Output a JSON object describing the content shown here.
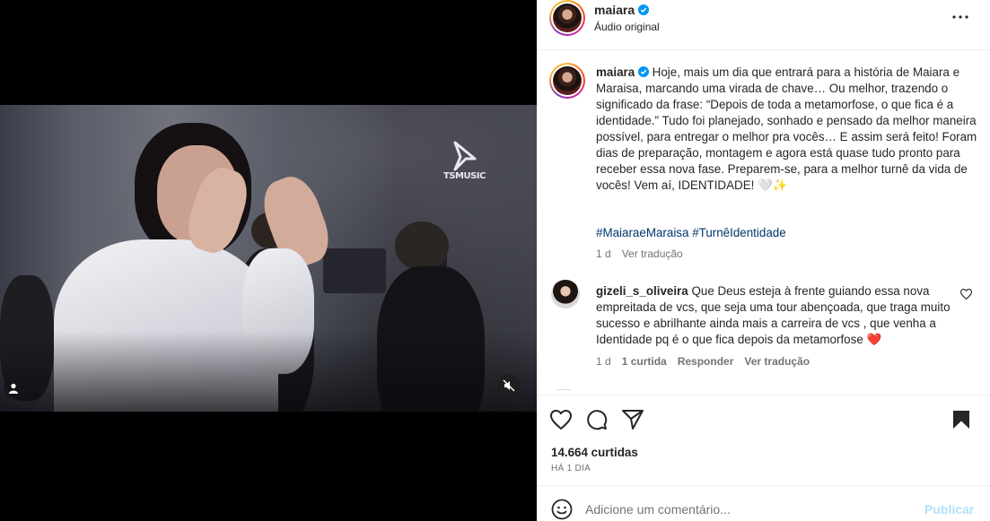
{
  "colors": {
    "link": "#00376b",
    "muted": "#737373",
    "text": "#262626",
    "verified": "#0095f6",
    "heart": "#ed4956",
    "post_disabled": "#b2dffc"
  },
  "media": {
    "watermark": "TSMUSIC",
    "user_tag_icon": "user-icon",
    "mute_icon": "muted-speaker-icon"
  },
  "header": {
    "username": "maiara",
    "subtitle": "Áudio original",
    "more_icon": "more-horizontal-icon"
  },
  "caption": {
    "username": "maiara",
    "text": "Hoje, mais um dia que entrará para a história de Maiara e Maraisa, marcando uma virada de chave… Ou melhor, trazendo o significado da frase: “Depois de toda a metamorfose, o que fica é a identidade.” Tudo foi planejado, sonhado e pensado da melhor maneira possível, para entregar o melhor pra vocês… E assim será feito! Foram dias de preparação, montagem e agora está quase tudo pronto para receber essa nova fase. Preparem-se, para a melhor turnê da vida de vocês! Vem aí, IDENTIDADE! 🤍✨",
    "hashtags": [
      "#MaiaraeMaraisa",
      "#TurnêIdentidade"
    ],
    "age": "1 d",
    "translate_label": "Ver tradução"
  },
  "comment": {
    "username": "gizeli_s_oliveira",
    "text": "Que Deus esteja à frente guiando essa nova empreitada de vcs, que seja uma tour abençoada, que traga muito sucesso e abrilhante ainda mais a carreira de vcs , que venha a Identidade pq é o que fica depois da metamorfose ❤️",
    "age": "1 d",
    "likes_label": "1 curtida",
    "reply_label": "Responder",
    "translate_label": "Ver tradução"
  },
  "actions": {
    "like_icon": "heart-icon",
    "comment_icon": "comment-icon",
    "share_icon": "send-icon",
    "save_icon": "bookmark-icon",
    "likes_text": "14.664 curtidas",
    "time_text": "HÁ 1 DIA"
  },
  "comment_box": {
    "emoji_icon": "emoji-icon",
    "placeholder": "Adicione um comentário...",
    "post_label": "Publicar"
  }
}
